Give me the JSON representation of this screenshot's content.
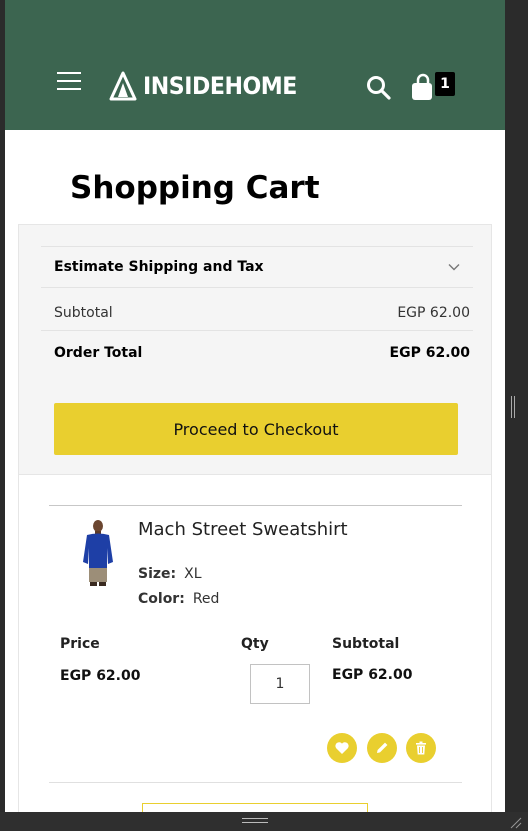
{
  "header": {
    "logo_text": "INSIDEHOME",
    "cart_count": "1",
    "bg_color": "#3c6550",
    "icons": [
      "menu-icon",
      "logo-icon",
      "search-icon",
      "shopping-bag-icon"
    ]
  },
  "page": {
    "title": "Shopping Cart"
  },
  "summary": {
    "estimate_label": "Estimate Shipping and Tax",
    "subtotal_label": "Subtotal",
    "subtotal_value": "EGP 62.00",
    "order_total_label": "Order Total",
    "order_total_value": "EGP 62.00",
    "checkout_label": "Proceed to Checkout",
    "accent_color": "#e9cf2f"
  },
  "item": {
    "name": "Mach Street Sweatshirt",
    "options": [
      {
        "label": "Size:",
        "value": "XL"
      },
      {
        "label": "Color:",
        "value": "Red"
      }
    ],
    "price_label": "Price",
    "price_value": "EGP 62.00",
    "qty_label": "Qty",
    "qty_value": "1",
    "subtotal_label": "Subtotal",
    "subtotal_value": "EGP 62.00",
    "actions": [
      "heart-icon",
      "pencil-icon",
      "trash-icon"
    ]
  }
}
